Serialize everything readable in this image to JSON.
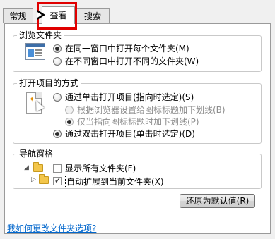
{
  "tabs": [
    {
      "label": "常规"
    },
    {
      "label": "查看"
    },
    {
      "label": "搜索"
    }
  ],
  "browse_folders": {
    "title": "浏览文件夹",
    "options": [
      {
        "label": "在同一窗口中打开每个文件夹(M)",
        "checked": true
      },
      {
        "label": "在不同窗口中打开不同的文件夹(W)",
        "checked": false
      }
    ]
  },
  "open_items": {
    "title": "打开项目的方式",
    "options": [
      {
        "label": "通过单击打开项目(指向时选定)(S)",
        "checked": false
      },
      {
        "label": "根据浏览器设置给图标标题加下划线(B)",
        "checked": false,
        "disabled": true
      },
      {
        "label": "仅当指向图标标题时加下划线(P)",
        "checked": true,
        "disabled": true
      },
      {
        "label": "通过双击打开项目(单击时选定)(D)",
        "checked": true
      }
    ]
  },
  "nav_pane": {
    "title": "导航窗格",
    "options": [
      {
        "label": "显示所有文件夹(F)",
        "checked": false
      },
      {
        "label": "自动扩展到当前文件夹(X)",
        "checked": true
      }
    ]
  },
  "restore_button": {
    "label": "还原为默认值(R)"
  },
  "help_link": {
    "label": "我如何更改文件夹选项?"
  }
}
